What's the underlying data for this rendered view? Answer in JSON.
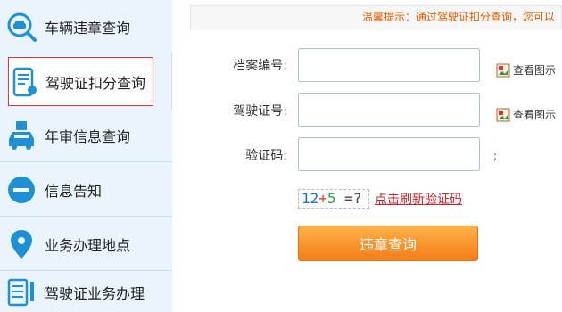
{
  "sidebar": {
    "items": [
      {
        "label": "车辆违章查询",
        "icon": "car-search-icon"
      },
      {
        "label": "驾驶证扣分查询",
        "icon": "phone-id-card-icon"
      },
      {
        "label": "年审信息查询",
        "icon": "car-inspection-icon"
      },
      {
        "label": "信息告知",
        "icon": "minus-circle-icon"
      },
      {
        "label": "业务办理地点",
        "icon": "location-pin-icon"
      },
      {
        "label": "驾驶证业务办理",
        "icon": "document-list-icon"
      }
    ],
    "active_index": 1
  },
  "notice": {
    "text": "温馨提示：通过驾驶证扣分查询，您可以"
  },
  "form": {
    "file_no_label": "档案编号:",
    "file_no_value": "",
    "license_no_label": "驾驶证号:",
    "license_no_value": "",
    "captcha_label": "验证码:",
    "captcha_value": "",
    "view_sample_label": "查看图示",
    "separator": ";",
    "captcha_image": {
      "p1": "12",
      "p2": "+",
      "p3": "5",
      "p4": " =?"
    },
    "refresh_label": "点击刷新验证码",
    "submit_label": "违章查询"
  },
  "colors": {
    "accent_orange": "#f57d17",
    "link_red": "#c0242b",
    "notice_orange": "#e05a00",
    "sidebar_bg": "#eaf4fb",
    "icon_blue": "#1e90d6"
  }
}
